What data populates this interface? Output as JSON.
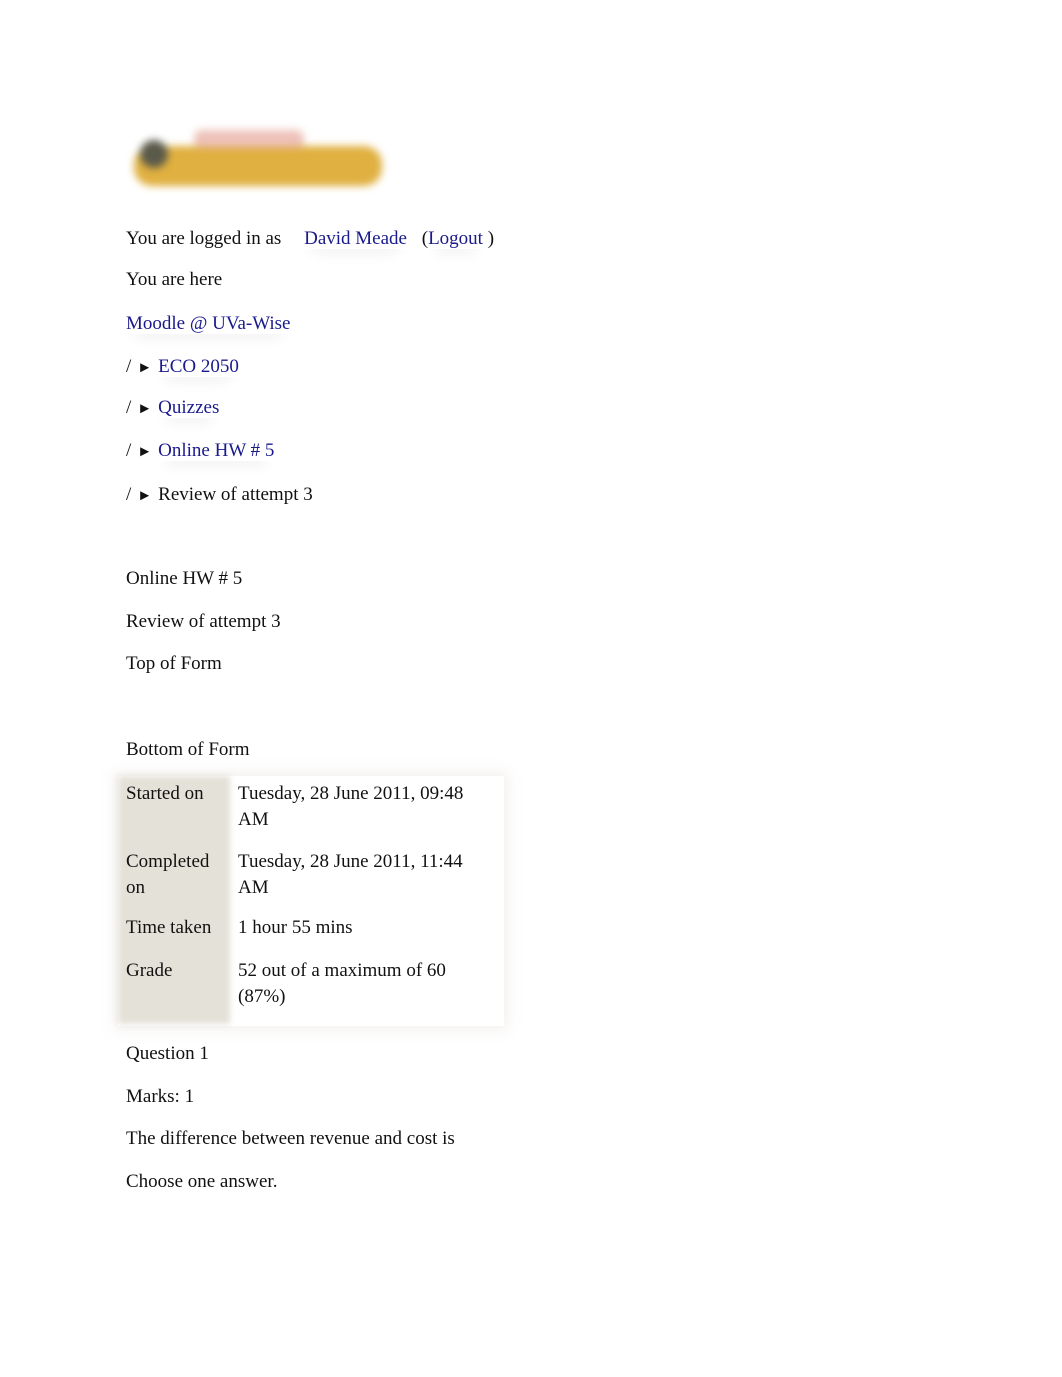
{
  "header": {
    "logo_name": "moodle-logo",
    "logged_in_prefix": "You are logged in as",
    "user_name": "David Meade",
    "logout_open": "(",
    "logout_label": "Logout",
    "logout_close": ")"
  },
  "breadcrumb": {
    "label": "You are here",
    "home": "Moodle @ UVa-Wise",
    "separator": "/",
    "arrow": "►",
    "items": [
      {
        "label": "ECO 2050",
        "link": true
      },
      {
        "label": "Quizzes",
        "link": true
      },
      {
        "label": "Online HW # 5",
        "link": true
      },
      {
        "label": "Review of attempt 3",
        "link": false
      }
    ]
  },
  "main": {
    "quiz_title": "Online HW # 5",
    "attempt_title": "Review of attempt 3",
    "top_of_form": "Top of Form",
    "bottom_of_form": "Bottom of Form",
    "summary": [
      {
        "label": "Started on",
        "value": "Tuesday, 28 June 2011, 09:48 AM"
      },
      {
        "label": "Completed on",
        "value": "Tuesday, 28 June 2011, 11:44 AM"
      },
      {
        "label": "Time taken",
        "value": "1 hour 55 mins"
      },
      {
        "label": "Grade",
        "value": "52 out of a maximum of 60 (87%)"
      }
    ],
    "question": {
      "number": "Question 1",
      "marks": "Marks: 1",
      "text": "The difference between revenue and cost is",
      "instruction": "Choose one answer."
    }
  }
}
